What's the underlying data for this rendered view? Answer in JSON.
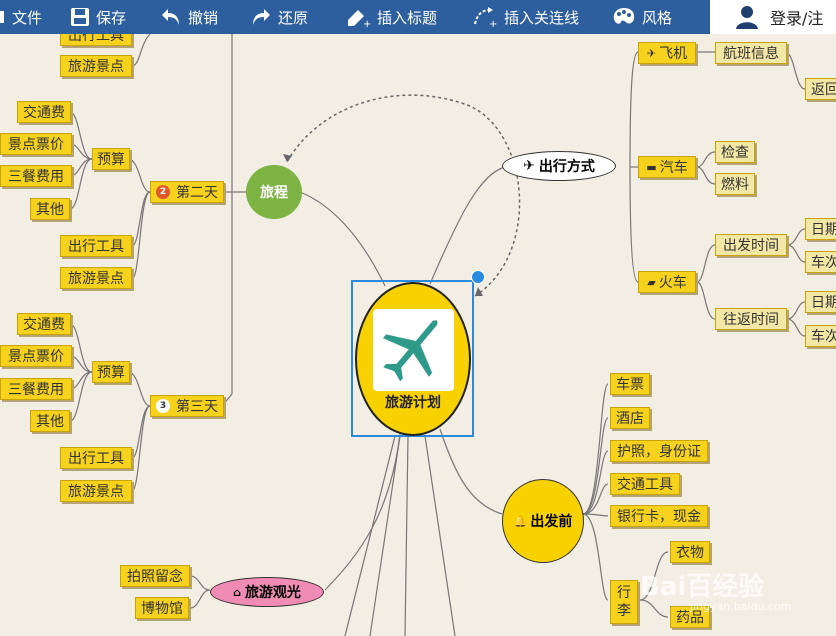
{
  "toolbar": {
    "items": [
      {
        "label": "文件",
        "icon": "file-icon"
      },
      {
        "label": "保存",
        "icon": "save-icon"
      },
      {
        "label": "撤销",
        "icon": "undo-icon"
      },
      {
        "label": "还原",
        "icon": "redo-icon"
      },
      {
        "label": "插入标题",
        "icon": "insert-title-icon"
      },
      {
        "label": "插入关连线",
        "icon": "insert-link-icon"
      },
      {
        "label": "风格",
        "icon": "palette-icon"
      }
    ],
    "login_label": "登录/注"
  },
  "center": {
    "label": "旅游计划",
    "icon": "airplane-icon"
  },
  "trip": {
    "label": "旅程",
    "top_partial": [
      "出行工具",
      "旅游景点"
    ],
    "day2": {
      "label": "第二天",
      "badge": "2",
      "budget_label": "预算",
      "budget_items": [
        "交通费",
        "景点票价",
        "三餐费用",
        "其他"
      ],
      "other_items": [
        "出行工具",
        "旅游景点"
      ]
    },
    "day3": {
      "label": "第三天",
      "badge": "3",
      "budget_label": "预算",
      "budget_items": [
        "交通费",
        "景点票价",
        "三餐费用",
        "其他"
      ],
      "other_items": [
        "出行工具",
        "旅游景点"
      ]
    }
  },
  "transport": {
    "label": "出行方式",
    "plane": {
      "label": "飞机",
      "children": [
        "航班信息"
      ],
      "partial": "返回"
    },
    "car": {
      "label": "汽车",
      "children": [
        "检查",
        "燃料"
      ]
    },
    "train": {
      "label": "火车",
      "depart": {
        "label": "出发时间",
        "children": [
          "日期",
          "车次"
        ]
      },
      "return": {
        "label": "往返时间",
        "children": [
          "日期",
          "车次"
        ]
      }
    }
  },
  "before": {
    "label": "出发前",
    "items": [
      "车票",
      "酒店",
      "护照，身份证",
      "交通工具",
      "银行卡，现金"
    ],
    "luggage": {
      "label": "行李",
      "children": [
        "衣物",
        "药品"
      ]
    }
  },
  "sightseeing": {
    "label": "旅游观光",
    "children": [
      "拍照留念",
      "博物馆"
    ]
  },
  "watermark": {
    "text": "Bai百经验",
    "sub": "jingyan.baidu.com"
  },
  "colors": {
    "toolbar": "#2d5f9e",
    "node": "#f7d21c",
    "center": "#f8d100",
    "trip": "#7cb342",
    "sightseeing": "#f08cb4",
    "teal_plane": "#2e9a8a"
  }
}
